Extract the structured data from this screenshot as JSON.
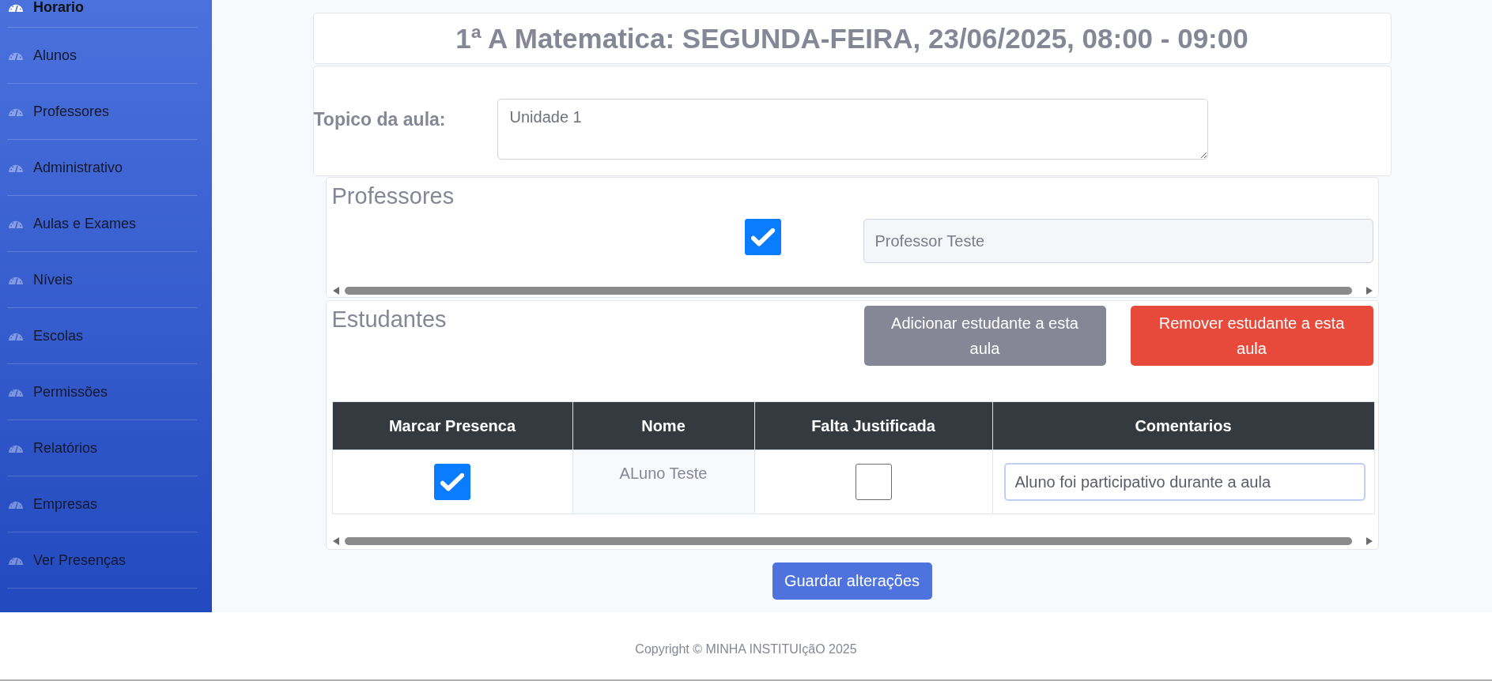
{
  "sidebar": {
    "items": [
      {
        "label": "Horario",
        "selected": true
      },
      {
        "label": "Alunos",
        "selected": false
      },
      {
        "label": "Professores",
        "selected": false
      },
      {
        "label": "Administrativo",
        "selected": false
      },
      {
        "label": "Aulas e Exames",
        "selected": false
      },
      {
        "label": "Níveis",
        "selected": false
      },
      {
        "label": "Escolas",
        "selected": false
      },
      {
        "label": "Permissões",
        "selected": false
      },
      {
        "label": "Relatórios",
        "selected": false
      },
      {
        "label": "Empresas",
        "selected": false
      },
      {
        "label": "Ver Presenças",
        "selected": false
      }
    ]
  },
  "header": {
    "title": "1ª A Matematica: SEGUNDA-FEIRA, 23/06/2025, 08:00 - 09:00"
  },
  "topic": {
    "label": "Topico da aula:",
    "value": "Unidade 1"
  },
  "teachers": {
    "title": "Professores",
    "rows": [
      {
        "checked": true,
        "value": "Professor Teste"
      }
    ]
  },
  "students": {
    "title": "Estudantes",
    "buttons": [
      {
        "label": "Adicionar estudante a esta aula",
        "kind": "secondary"
      },
      {
        "label": "Remover estudante a esta aula",
        "kind": "danger"
      }
    ],
    "table": {
      "columns": [
        "Marcar Presenca",
        "Nome",
        "Falta Justificada",
        "Comentarios"
      ],
      "rows": [
        {
          "cells": [
            {
              "kind": "checkbox",
              "checked": true
            },
            {
              "kind": "text",
              "text": "ALuno Teste"
            },
            {
              "kind": "checkbox",
              "checked": false
            },
            {
              "kind": "input",
              "value": "Aluno foi participativo durante a aula",
              "focused": true
            }
          ]
        }
      ]
    }
  },
  "save_button": {
    "label": "Guardar alterações"
  },
  "footer": {
    "text": "Copyright © MINHA INSTITUIçãO 2025"
  }
}
